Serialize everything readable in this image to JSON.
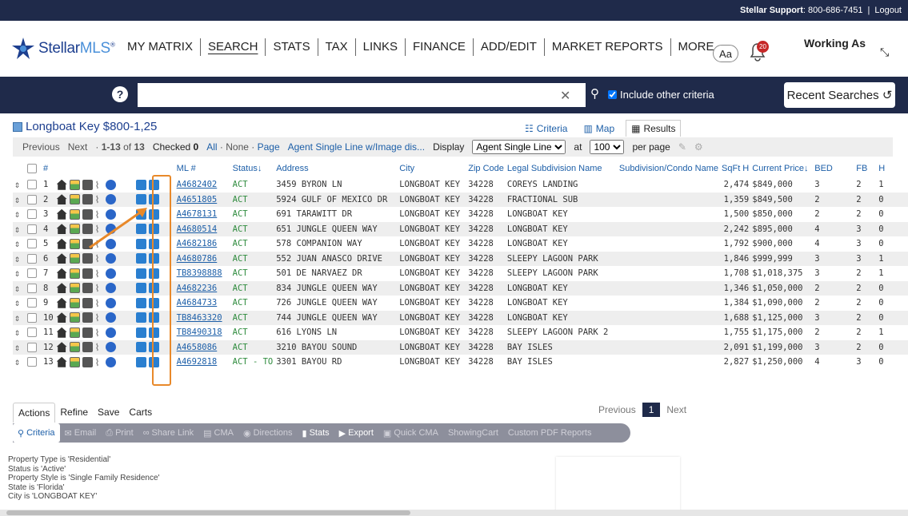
{
  "topbar": {
    "support_label": "Stellar Support",
    "support_phone": ": 800-686-7451",
    "logout": "Logout"
  },
  "logo": {
    "brand": "Stellar",
    "brand2": "MLS"
  },
  "nav": [
    "MY MATRIX",
    "SEARCH",
    "STATS",
    "TAX",
    "LINKS",
    "FINANCE",
    "ADD/EDIT",
    "MARKET REPORTS",
    "MORE"
  ],
  "header": {
    "aa": "Aa",
    "bell_count": "20",
    "working_as": "Working As"
  },
  "search": {
    "help": "?",
    "placeholder": "",
    "include_label": "Include other criteria",
    "recent": "Recent Searches"
  },
  "results": {
    "title": "Longboat Key $800-1,25",
    "tabs": [
      "Criteria",
      "Map",
      "Results"
    ],
    "pager": {
      "previous": "Previous",
      "next": "Next",
      "range": "1-13",
      "of": "of",
      "total": "13",
      "checked_label": "Checked",
      "checked_count": "0",
      "all": "All",
      "none": "None",
      "page": "Page",
      "display_name": "Agent Single Line w/Image dis...",
      "display_label": "Display",
      "display_value": "Agent Single Line",
      "at": "at",
      "per_page_value": "100",
      "per_page": "per page"
    },
    "columns": [
      "#",
      "ML #",
      "Status",
      "Address",
      "City",
      "Zip Code",
      "Legal Subdivision Name",
      "Subdivision/Condo Name",
      "SqFt H",
      "Current Price",
      "BED",
      "FB",
      "H"
    ],
    "rows": [
      {
        "n": "1",
        "ml": "A4682402",
        "status": "ACT",
        "addr": "3459 BYRON LN",
        "city": "LONGBOAT KEY",
        "zip": "34228",
        "legal": "COREYS LANDING",
        "sqft": "2,474",
        "price": "$849,000",
        "bed": "3",
        "fb": "2",
        "h": "1"
      },
      {
        "n": "2",
        "ml": "A4651805",
        "status": "ACT",
        "addr": "5924 GULF OF MEXICO DR",
        "city": "LONGBOAT KEY",
        "zip": "34228",
        "legal": "FRACTIONAL SUB",
        "sqft": "1,359",
        "price": "$849,500",
        "bed": "2",
        "fb": "2",
        "h": "0"
      },
      {
        "n": "3",
        "ml": "A4678131",
        "status": "ACT",
        "addr": "691 TARAWITT DR",
        "city": "LONGBOAT KEY",
        "zip": "34228",
        "legal": "LONGBOAT KEY",
        "sqft": "1,500",
        "price": "$850,000",
        "bed": "2",
        "fb": "2",
        "h": "0"
      },
      {
        "n": "4",
        "ml": "A4680514",
        "status": "ACT",
        "addr": "651 JUNGLE QUEEN WAY",
        "city": "LONGBOAT KEY",
        "zip": "34228",
        "legal": "LONGBOAT KEY",
        "sqft": "2,242",
        "price": "$895,000",
        "bed": "4",
        "fb": "3",
        "h": "0"
      },
      {
        "n": "5",
        "ml": "A4682186",
        "status": "ACT",
        "addr": "578 COMPANION WAY",
        "city": "LONGBOAT KEY",
        "zip": "34228",
        "legal": "LONGBOAT KEY",
        "sqft": "1,792",
        "price": "$900,000",
        "bed": "4",
        "fb": "3",
        "h": "0"
      },
      {
        "n": "6",
        "ml": "A4680786",
        "status": "ACT",
        "addr": "552 JUAN ANASCO DRIVE",
        "city": "LONGBOAT KEY",
        "zip": "34228",
        "legal": "SLEEPY LAGOON PARK",
        "sqft": "1,846",
        "price": "$999,999",
        "bed": "3",
        "fb": "3",
        "h": "1"
      },
      {
        "n": "7",
        "ml": "TB8398888",
        "status": "ACT",
        "addr": "501 DE NARVAEZ DR",
        "city": "LONGBOAT KEY",
        "zip": "34228",
        "legal": "SLEEPY LAGOON PARK",
        "sqft": "1,708",
        "price": "$1,018,375",
        "bed": "3",
        "fb": "2",
        "h": "1"
      },
      {
        "n": "8",
        "ml": "A4682236",
        "status": "ACT",
        "addr": "834 JUNGLE QUEEN WAY",
        "city": "LONGBOAT KEY",
        "zip": "34228",
        "legal": "LONGBOAT KEY",
        "sqft": "1,346",
        "price": "$1,050,000",
        "bed": "2",
        "fb": "2",
        "h": "0"
      },
      {
        "n": "9",
        "ml": "A4684733",
        "status": "ACT",
        "addr": "726 JUNGLE QUEEN WAY",
        "city": "LONGBOAT KEY",
        "zip": "34228",
        "legal": "LONGBOAT KEY",
        "sqft": "1,384",
        "price": "$1,090,000",
        "bed": "2",
        "fb": "2",
        "h": "0"
      },
      {
        "n": "10",
        "ml": "TB8463320",
        "status": "ACT",
        "addr": "744 JUNGLE QUEEN WAY",
        "city": "LONGBOAT KEY",
        "zip": "34228",
        "legal": "LONGBOAT KEY",
        "sqft": "1,688",
        "price": "$1,125,000",
        "bed": "3",
        "fb": "2",
        "h": "0"
      },
      {
        "n": "11",
        "ml": "TB8490318",
        "status": "ACT",
        "addr": "616 LYONS LN",
        "city": "LONGBOAT KEY",
        "zip": "34228",
        "legal": "SLEEPY LAGOON PARK 2",
        "sqft": "1,755",
        "price": "$1,175,000",
        "bed": "2",
        "fb": "2",
        "h": "1"
      },
      {
        "n": "12",
        "ml": "A4658086",
        "status": "ACT",
        "addr": "3210 BAYOU SOUND",
        "city": "LONGBOAT KEY",
        "zip": "34228",
        "legal": "BAY ISLES",
        "sqft": "2,091",
        "price": "$1,199,000",
        "bed": "3",
        "fb": "2",
        "h": "0"
      },
      {
        "n": "13",
        "ml": "A4692818",
        "status": "ACT - TO",
        "addr": "3301 BAYOU RD",
        "city": "LONGBOAT KEY",
        "zip": "34228",
        "legal": "BAY ISLES",
        "sqft": "2,827",
        "price": "$1,250,000",
        "bed": "4",
        "fb": "3",
        "h": "0"
      }
    ]
  },
  "bottom": {
    "tabs": [
      "Actions",
      "Refine",
      "Save",
      "Carts"
    ],
    "previous": "Previous",
    "page": "1",
    "next": "Next",
    "actions": [
      "Criteria",
      "Email",
      "Print",
      "Share Link",
      "CMA",
      "Directions",
      "Stats",
      "Export",
      "Quick CMA",
      "ShowingCart",
      "Custom PDF Reports"
    ],
    "criteria": [
      "Property Type is 'Residential'",
      "Status is 'Active'",
      "Property Style is 'Single Family Residence'",
      "State is 'Florida'",
      "City is 'LONGBOAT KEY'"
    ]
  },
  "colors": {
    "navy": "#1f2a4a",
    "link": "#1d5fa8",
    "status_green": "#2e8b3d",
    "highlight": "#e8892a"
  }
}
